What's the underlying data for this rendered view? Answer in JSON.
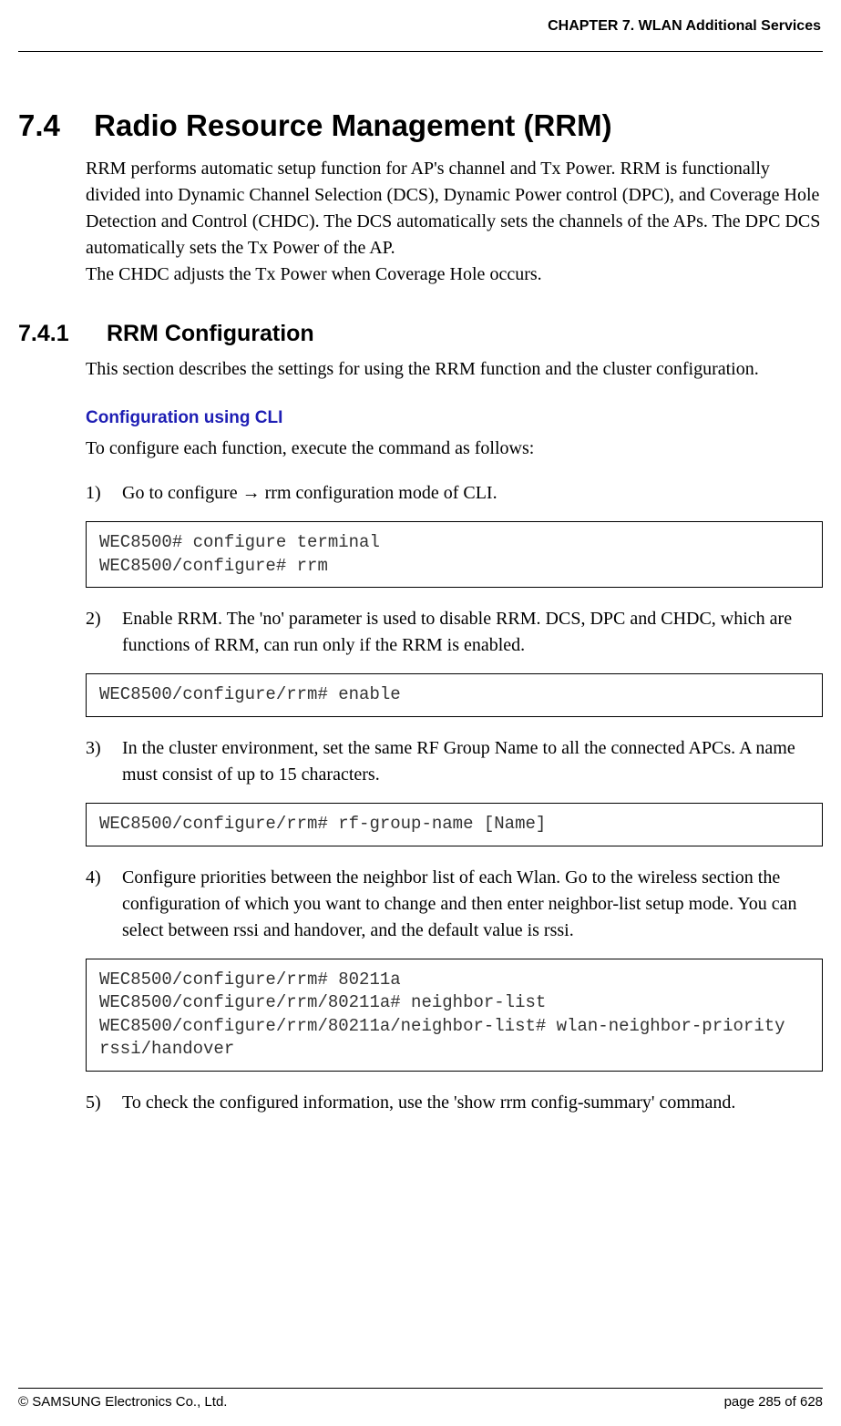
{
  "header": {
    "chapter": "CHAPTER 7. WLAN Additional Services"
  },
  "section": {
    "num": "7.4",
    "title": "Radio Resource Management (RRM)",
    "intro": "RRM performs automatic setup function for AP's channel and Tx Power. RRM is functionally divided into Dynamic Channel Selection (DCS), Dynamic Power control (DPC), and Coverage Hole Detection and Control (CHDC). The DCS automatically sets the channels of the APs. The DPC DCS automatically sets the Tx Power of the AP.",
    "intro2": "The CHDC adjusts the Tx Power when Coverage Hole occurs."
  },
  "subsection": {
    "num": "7.4.1",
    "title": "RRM Configuration",
    "desc": "This section describes the settings for using the RRM function and the cluster configuration."
  },
  "cli": {
    "heading": "Configuration using CLI",
    "intro": "To configure each function, execute the command as follows:",
    "steps": [
      {
        "n": "1)",
        "text_pre": "Go to configure ",
        "arrow": "→",
        "text_post": " rrm configuration mode of CLI.",
        "code": "WEC8500# configure terminal\nWEC8500/configure# rrm"
      },
      {
        "n": "2)",
        "text": "Enable RRM. The 'no' parameter is used to disable RRM. DCS, DPC and CHDC, which are functions of RRM, can run only if the RRM is enabled.",
        "code": "WEC8500/configure/rrm# enable"
      },
      {
        "n": "3)",
        "text": "In the cluster environment, set the same RF Group Name to all the connected APCs. A name must consist of up to 15 characters.",
        "code": "WEC8500/configure/rrm# rf-group-name [Name]"
      },
      {
        "n": "4)",
        "text": "Configure priorities between the neighbor list of each Wlan. Go to the wireless section the configuration of which you want to change and then enter neighbor-list setup mode. You can select between rssi and handover, and the default value is rssi.",
        "code": "WEC8500/configure/rrm# 80211a\nWEC8500/configure/rrm/80211a# neighbor-list\nWEC8500/configure/rrm/80211a/neighbor-list# wlan-neighbor-priority rssi/handover"
      },
      {
        "n": "5)",
        "text": "To check the configured information, use the 'show rrm config-summary' command."
      }
    ]
  },
  "footer": {
    "copyright": "© SAMSUNG Electronics Co., Ltd.",
    "page": "page 285 of 628"
  }
}
